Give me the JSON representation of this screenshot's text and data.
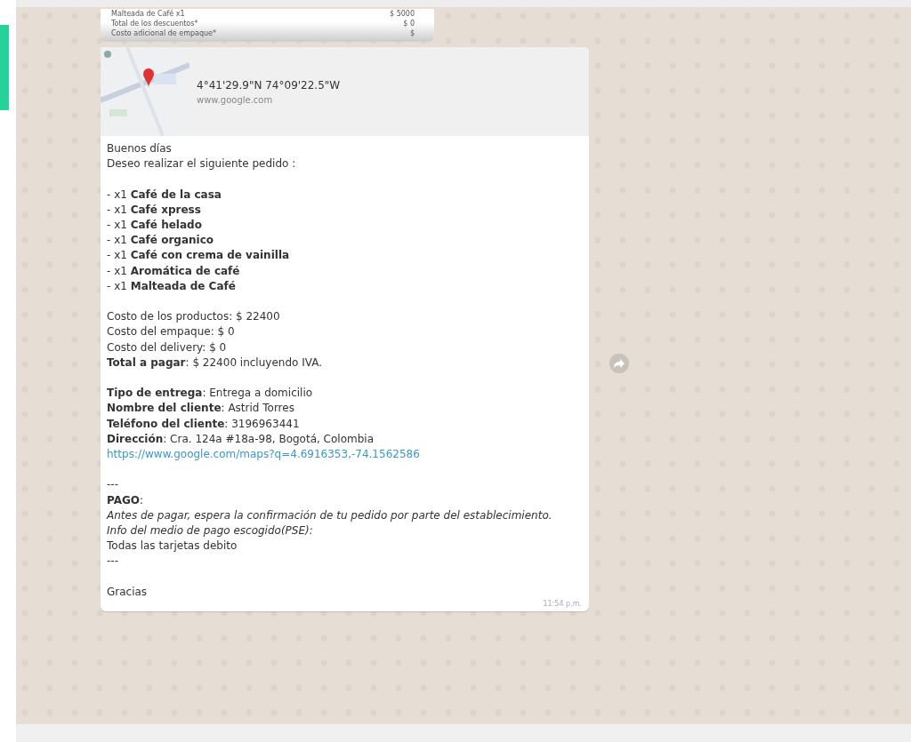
{
  "previous_message": {
    "rows": [
      {
        "label": "Malteada de Café x1",
        "value": "$ 5000"
      },
      {
        "label": "Total de los descuentos*",
        "value": "$ 0"
      },
      {
        "label": "Costo adicional de empaque*",
        "value": "$"
      }
    ]
  },
  "location": {
    "coordinates": "4°41'29.9\"N 74°09'22.5\"W",
    "site": "www.google.com"
  },
  "message": {
    "lines": [
      {
        "kind": "text",
        "text": "Buenos días"
      },
      {
        "kind": "text",
        "text": "Deseo realizar el siguiente pedido :"
      },
      {
        "kind": "gap"
      },
      {
        "kind": "text",
        "text": "- x1 **Café de la casa**"
      },
      {
        "kind": "text",
        "text": "- x1 **Café xpress**"
      },
      {
        "kind": "text",
        "text": "- x1 **Café helado**"
      },
      {
        "kind": "text",
        "text": "- x1 **Café organico**"
      },
      {
        "kind": "text",
        "text": "- x1 **Café con crema de vainilla**"
      },
      {
        "kind": "text",
        "text": "- x1 **Aromática de café**"
      },
      {
        "kind": "text",
        "text": "- x1 **Malteada de Café**"
      },
      {
        "kind": "gap"
      },
      {
        "kind": "text",
        "text": "Costo de los productos: $ 22400"
      },
      {
        "kind": "text",
        "text": "Costo del empaque: $ 0"
      },
      {
        "kind": "text",
        "text": "Costo del delivery: $ 0"
      },
      {
        "kind": "text",
        "text": "**Total a pagar**: $ 22400 incluyendo IVA."
      },
      {
        "kind": "gap"
      },
      {
        "kind": "text",
        "text": "**Tipo de entrega**: Entrega a domicilio"
      },
      {
        "kind": "text",
        "text": "**Nombre del cliente**: Astrid Torres"
      },
      {
        "kind": "text",
        "text": "**Teléfono del cliente**: 3196963441"
      },
      {
        "kind": "text",
        "text": "**Dirección**: Cra. 124a #18a-98, Bogotá, Colombia"
      },
      {
        "kind": "link",
        "text": "https://www.google.com/maps?q=4.6916353,-74.1562586"
      },
      {
        "kind": "gap"
      },
      {
        "kind": "text",
        "text": "---"
      },
      {
        "kind": "text",
        "text": "**PAGO**:"
      },
      {
        "kind": "italic",
        "text": "Antes de pagar, espera la confirmación de tu pedido por parte del establecimiento."
      },
      {
        "kind": "italic",
        "text": "Info del medio de pago escogido(PSE):"
      },
      {
        "kind": "text",
        "text": "Todas las tarjetas debito"
      },
      {
        "kind": "text",
        "text": "---"
      },
      {
        "kind": "gap"
      },
      {
        "kind": "text",
        "text": "Gracias"
      }
    ],
    "time": "11:54 p.m."
  }
}
